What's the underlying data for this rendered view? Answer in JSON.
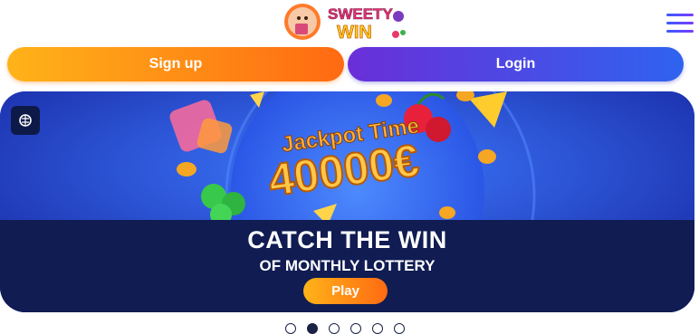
{
  "header": {
    "logo_line1": "SWEETY",
    "logo_line2": "WIN"
  },
  "auth": {
    "signup_label": "Sign up",
    "login_label": "Login"
  },
  "banner": {
    "headline_line1": "Jackpot Time",
    "headline_amount": "40000€",
    "title": "CATCH THE WIN",
    "subtitle": "OF MONTHLY LOTTERY",
    "play_label": "Play"
  },
  "carousel": {
    "total_slides": 6,
    "active_index": 1
  },
  "colors": {
    "accent_orange": "#ff6a12",
    "accent_blue": "#2f63f0",
    "banner_dark": "#101c52"
  }
}
